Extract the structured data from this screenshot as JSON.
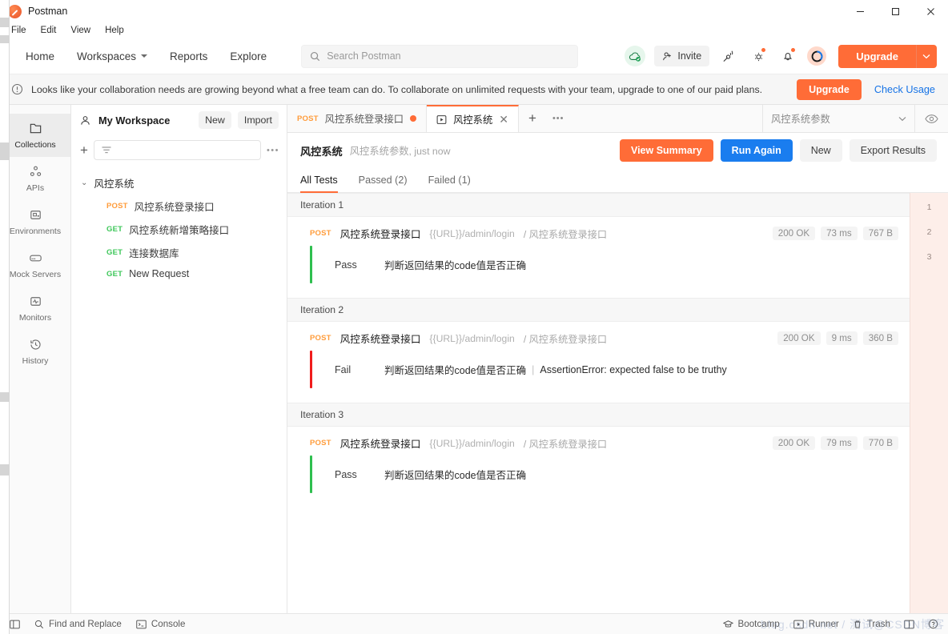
{
  "window": {
    "app_name": "Postman",
    "controls": {
      "minimize": "minimize-icon",
      "maximize": "maximize-icon",
      "close": "close-icon"
    }
  },
  "menubar": {
    "items": [
      "File",
      "Edit",
      "View",
      "Help"
    ]
  },
  "navbar": {
    "links": [
      {
        "label": "Home",
        "has_caret": false
      },
      {
        "label": "Workspaces",
        "has_caret": true
      },
      {
        "label": "Reports",
        "has_caret": false
      },
      {
        "label": "Explore",
        "has_caret": false
      }
    ],
    "search": {
      "placeholder": "Search Postman",
      "value": ""
    },
    "invite_label": "Invite",
    "upgrade_label": "Upgrade",
    "icons": [
      "cloud-sync-icon",
      "invite-icon",
      "satellite-icon",
      "gear-icon",
      "bell-icon",
      "avatar-icon"
    ]
  },
  "banner": {
    "message": "Looks like your collaboration needs are growing beyond what a free team can do. To collaborate on unlimited requests with your team, upgrade to one of our paid plans.",
    "upgrade_label": "Upgrade",
    "check_usage_label": "Check Usage"
  },
  "rail": {
    "items": [
      {
        "label": "Collections",
        "icon": "collections-icon",
        "active": true
      },
      {
        "label": "APIs",
        "icon": "apis-icon",
        "active": false
      },
      {
        "label": "Environments",
        "icon": "environments-icon",
        "active": false
      },
      {
        "label": "Mock Servers",
        "icon": "mock-servers-icon",
        "active": false
      },
      {
        "label": "Monitors",
        "icon": "monitors-icon",
        "active": false
      },
      {
        "label": "History",
        "icon": "history-icon",
        "active": false
      }
    ]
  },
  "sidebar": {
    "workspace_name": "My Workspace",
    "new_label": "New",
    "import_label": "Import",
    "filter_placeholder": "",
    "collection": {
      "name": "风控系统",
      "requests": [
        {
          "method": "POST",
          "name": "风控系统登录接口"
        },
        {
          "method": "GET",
          "name": "风控系统新增策略接口"
        },
        {
          "method": "GET",
          "name": "连接数据库"
        },
        {
          "method": "GET",
          "name": "New Request"
        }
      ]
    }
  },
  "tabbar": {
    "tabs": [
      {
        "method": "POST",
        "label": "风控系统登录接口",
        "active": false,
        "unsaved": true,
        "runner": false
      },
      {
        "label": "风控系统",
        "active": true,
        "unsaved": false,
        "runner": true
      }
    ],
    "environment": "风控系统参数"
  },
  "runner": {
    "title": "风控系统",
    "subtitle": "风控系统参数, just now",
    "buttons": {
      "view_summary": "View Summary",
      "run_again": "Run Again",
      "new": "New",
      "export_results": "Export Results"
    },
    "tabs": [
      {
        "label": "All Tests",
        "active": true
      },
      {
        "label": "Passed (2)",
        "active": false
      },
      {
        "label": "Failed (1)",
        "active": false
      }
    ],
    "minimap": [
      "1",
      "2",
      "3"
    ],
    "iterations": [
      {
        "label": "Iteration 1",
        "request": {
          "method": "POST",
          "name": "风控系统登录接口",
          "url": "{{URL}}/admin/login",
          "path": "/ 风控系统登录接口",
          "status": "200 OK",
          "time": "73 ms",
          "size": "767 B"
        },
        "assertion": {
          "status": "Pass",
          "text": "判断返回结果的code值是否正确",
          "error": ""
        }
      },
      {
        "label": "Iteration 2",
        "request": {
          "method": "POST",
          "name": "风控系统登录接口",
          "url": "{{URL}}/admin/login",
          "path": "/ 风控系统登录接口",
          "status": "200 OK",
          "time": "9 ms",
          "size": "360 B"
        },
        "assertion": {
          "status": "Fail",
          "text": "判断返回结果的code值是否正确",
          "error": "AssertionError: expected false to be truthy"
        }
      },
      {
        "label": "Iteration 3",
        "request": {
          "method": "POST",
          "name": "风控系统登录接口",
          "url": "{{URL}}/admin/login",
          "path": "/ 风控系统登录接口",
          "status": "200 OK",
          "time": "79 ms",
          "size": "770 B"
        },
        "assertion": {
          "status": "Pass",
          "text": "判断返回结果的code值是否正确",
          "error": ""
        }
      }
    ]
  },
  "footer": {
    "left": [
      {
        "label": "",
        "icon": "sidebar-toggle-icon"
      },
      {
        "label": "Find and Replace",
        "icon": "search-icon"
      },
      {
        "label": "Console",
        "icon": "console-icon"
      }
    ],
    "right": [
      {
        "label": "Bootcamp",
        "icon": "bootcamp-icon"
      },
      {
        "label": "Runner",
        "icon": "runner-icon"
      },
      {
        "label": "Trash",
        "icon": "trash-icon"
      },
      {
        "label": "",
        "icon": "layout-icon"
      },
      {
        "label": "",
        "icon": "help-icon"
      }
    ]
  },
  "colors": {
    "accent": "#ff6c37",
    "blue": "#1a7def",
    "pass": "#2fbf4f",
    "fail": "#f01c1c",
    "post": "#ff9c3b",
    "get": "#3ec75a"
  }
}
